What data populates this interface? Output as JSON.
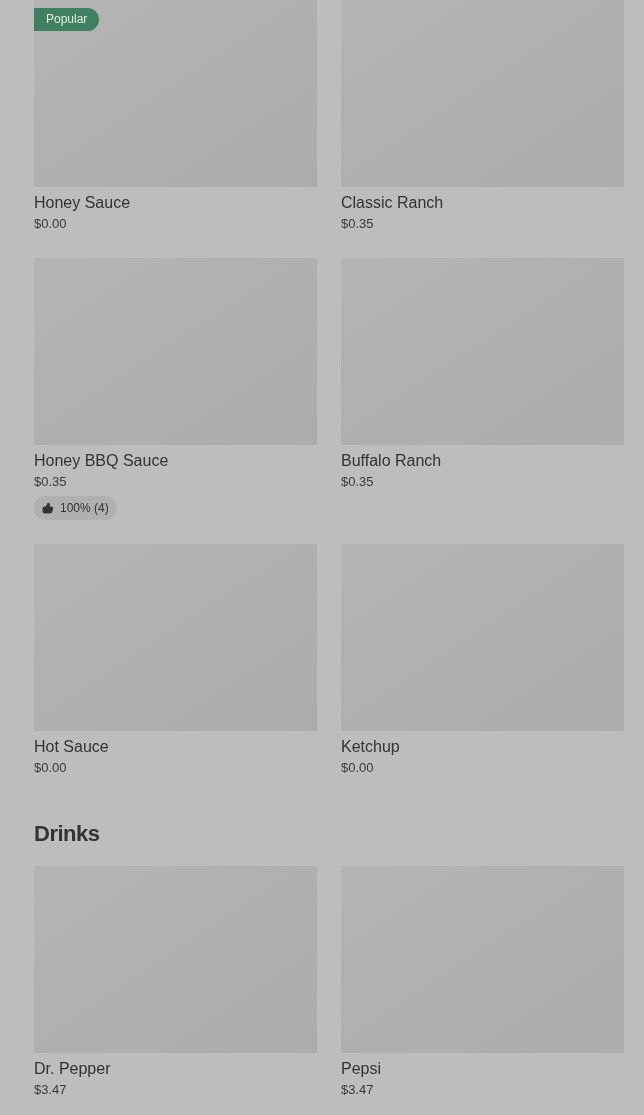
{
  "sections": [
    {
      "items": [
        {
          "name": "Honey Sauce",
          "price": "$0.00",
          "badge": "Popular"
        },
        {
          "name": "Classic Ranch",
          "price": "$0.35"
        },
        {
          "name": "Honey BBQ Sauce",
          "price": "$0.35",
          "rating": "100% (4)"
        },
        {
          "name": "Buffalo Ranch",
          "price": "$0.35"
        },
        {
          "name": "Hot Sauce",
          "price": "$0.00"
        },
        {
          "name": "Ketchup",
          "price": "$0.00"
        }
      ]
    },
    {
      "title": "Drinks",
      "items": [
        {
          "name": "Dr. Pepper",
          "price": "$3.47"
        },
        {
          "name": "Pepsi",
          "price": "$3.47"
        }
      ]
    }
  ]
}
